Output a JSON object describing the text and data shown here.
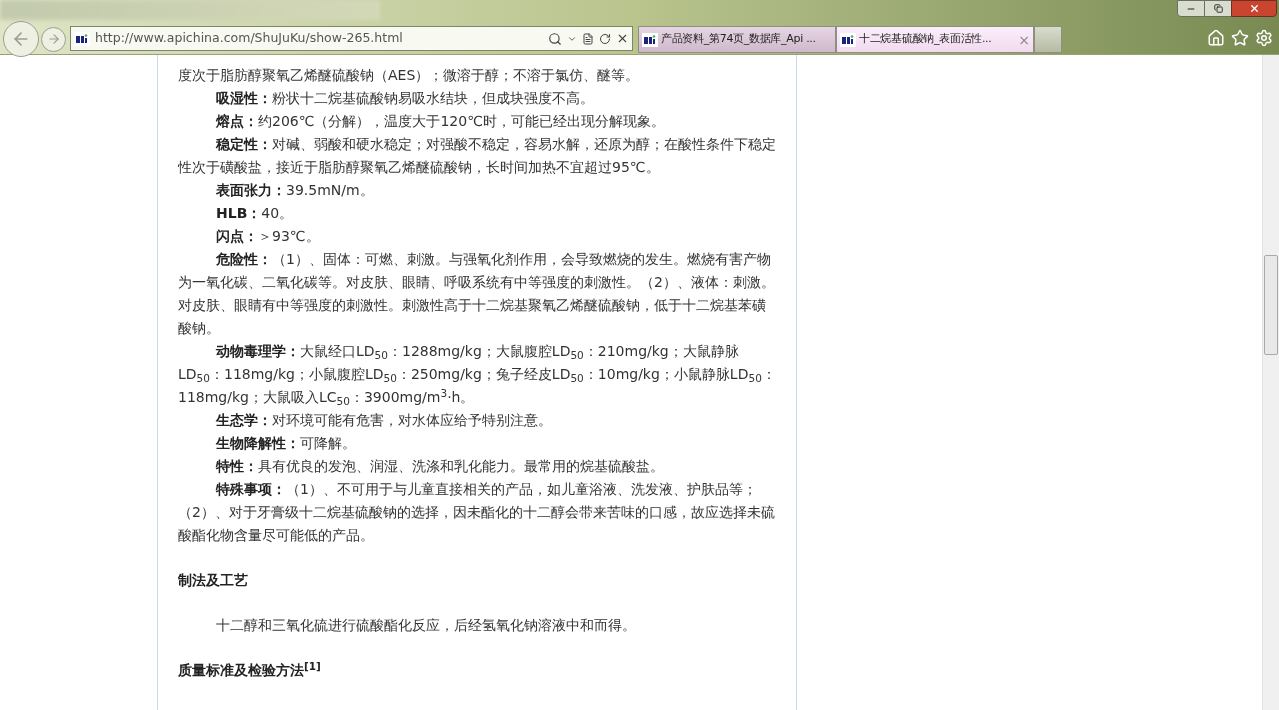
{
  "browser": {
    "address": "http://www.apichina.com/ShuJuKu/show-265.html",
    "tabs": [
      {
        "title": "产品资料_第74页_数据库_Api ...",
        "selected": false
      },
      {
        "title": "十二烷基硫酸钠_表面活性...",
        "selected": true
      }
    ],
    "tab_close": "×"
  },
  "article": {
    "blocks": [
      {
        "kind": "continuation",
        "text": "度次于脂肪醇聚氧乙烯醚硫酸钠（AES）；微溶于醇；不溶于氯仿、醚等。"
      },
      {
        "kind": "property",
        "label": "吸湿性：",
        "text": "粉状十二烷基硫酸钠易吸水结块，但成块强度不高。"
      },
      {
        "kind": "property",
        "label": "熔点：",
        "text": "约206℃（分解），温度大于120℃时，可能已经出现分解现象。"
      },
      {
        "kind": "property",
        "label": "稳定性：",
        "text": "对碱、弱酸和硬水稳定；对强酸不稳定，容易水解，还原为醇；在酸性条件下稳定性次于磺酸盐，接近于脂肪醇聚氧乙烯醚硫酸钠，长时间加热不宜超过95℃。"
      },
      {
        "kind": "property",
        "label": "表面张力：",
        "text": "39.5mN/m。"
      },
      {
        "kind": "property",
        "label": "HLB：",
        "text": "40。"
      },
      {
        "kind": "property",
        "label": "闪点：",
        "text": "＞93℃。"
      },
      {
        "kind": "property",
        "label": "危险性：",
        "text": "（1）、固体：可燃、刺激。与强氧化剂作用，会导致燃烧的发生。燃烧有害产物为一氧化碳、二氧化碳等。对皮肤、眼睛、呼吸系统有中等强度的刺激性。（2）、液体：刺激。对皮肤、眼睛有中等强度的刺激性。刺激性高于十二烷基聚氧乙烯醚硫酸钠，低于十二烷基苯磺酸钠。"
      },
      {
        "kind": "property",
        "label": "动物毒理学：",
        "text": "大鼠经口LD$_{50}$：1288mg/kg；大鼠腹腔LD$_{50}$：210mg/kg；大鼠静脉LD$_{50}$：118mg/kg；小鼠腹腔LD$_{50}$：250mg/kg；兔子经皮LD$_{50}$：10mg/kg；小鼠静脉LD$_{50}$：118mg/kg；大鼠吸入LC$_{50}$：3900mg/m$^{3}$·h。"
      },
      {
        "kind": "property",
        "label": "生态学：",
        "text": "对环境可能有危害，对水体应给予特别注意。"
      },
      {
        "kind": "property",
        "label": "生物降解性：",
        "text": "可降解。"
      },
      {
        "kind": "property",
        "label": "特性：",
        "text": "具有优良的发泡、润湿、洗涤和乳化能力。最常用的烷基硫酸盐。"
      },
      {
        "kind": "property",
        "label": "特殊事项：",
        "text": "（1）、不可用于与儿童直接相关的产品，如儿童浴液、洗发液、护肤品等；（2）、对于牙膏级十二烷基硫酸钠的选择，因未酯化的十二醇会带来苦味的口感，故应选择未硫酸酯化物含量尽可能低的产品。"
      },
      {
        "kind": "heading",
        "text": "制法及工艺"
      },
      {
        "kind": "body",
        "text": "十二醇和三氧化硫进行硫酸酯化反应，后经氢氧化钠溶液中和而得。"
      },
      {
        "kind": "heading",
        "text": "质量标准及检验方法$^{[1]}$"
      }
    ]
  }
}
